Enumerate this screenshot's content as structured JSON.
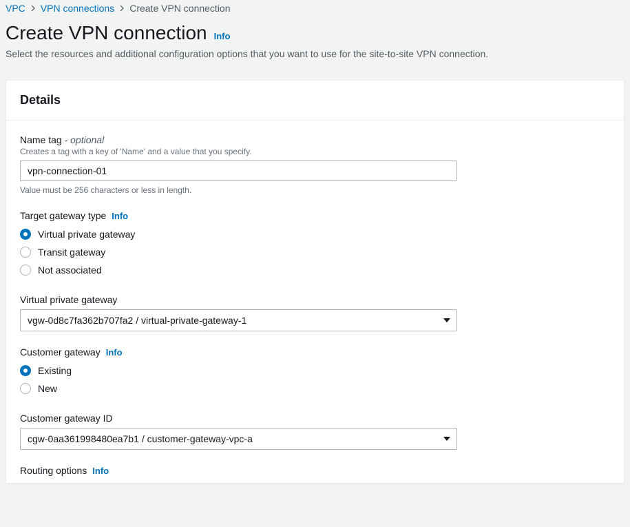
{
  "breadcrumb": {
    "items": [
      "VPC",
      "VPN connections",
      "Create VPN connection"
    ]
  },
  "page": {
    "title": "Create VPN connection",
    "info": "Info",
    "description": "Select the resources and additional configuration options that you want to use for the site-to-site VPN connection."
  },
  "panel": {
    "title": "Details"
  },
  "fields": {
    "name_tag": {
      "label": "Name tag",
      "optional_suffix": " - optional",
      "hint": "Creates a tag with a key of 'Name' and a value that you specify.",
      "value": "vpn-connection-01",
      "constraint": "Value must be 256 characters or less in length."
    },
    "target_gateway_type": {
      "label": "Target gateway type",
      "info": "Info",
      "options": [
        "Virtual private gateway",
        "Transit gateway",
        "Not associated"
      ],
      "selected": "Virtual private gateway"
    },
    "virtual_private_gateway": {
      "label": "Virtual private gateway",
      "value": "vgw-0d8c7fa362b707fa2 / virtual-private-gateway-1"
    },
    "customer_gateway": {
      "label": "Customer gateway",
      "info": "Info",
      "options": [
        "Existing",
        "New"
      ],
      "selected": "Existing"
    },
    "customer_gateway_id": {
      "label": "Customer gateway ID",
      "value": "cgw-0aa361998480ea7b1 / customer-gateway-vpc-a"
    },
    "routing_options": {
      "label": "Routing options",
      "info": "Info"
    }
  }
}
